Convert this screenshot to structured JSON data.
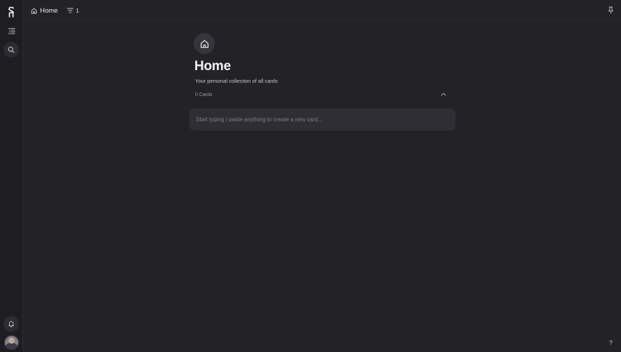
{
  "sidebar": {
    "logo": "logo-icon",
    "items": [
      {
        "icon": "tree-list-icon"
      },
      {
        "icon": "search-icon"
      }
    ],
    "bottom": [
      {
        "icon": "bell-icon"
      },
      {
        "icon": "avatar"
      }
    ]
  },
  "topbar": {
    "breadcrumb_label": "Home",
    "breadcrumb_icon": "home-icon",
    "filter_icon": "filter-icon",
    "filter_count": "1",
    "pin_icon": "pin-icon"
  },
  "main": {
    "hero_icon": "home-icon",
    "title": "Home",
    "subtitle": "Your personal collection of all cards",
    "card_count": "0 Cards",
    "collapse_icon": "chevron-up-icon",
    "new_card_placeholder": "Start typing / paste anything to create a new card...",
    "new_card_value": ""
  },
  "help_label": "?",
  "colors": {
    "background": "#232227",
    "sidebar": "#1e1d22",
    "input_bg": "#2f2e34",
    "text": "#f2f2f4"
  }
}
